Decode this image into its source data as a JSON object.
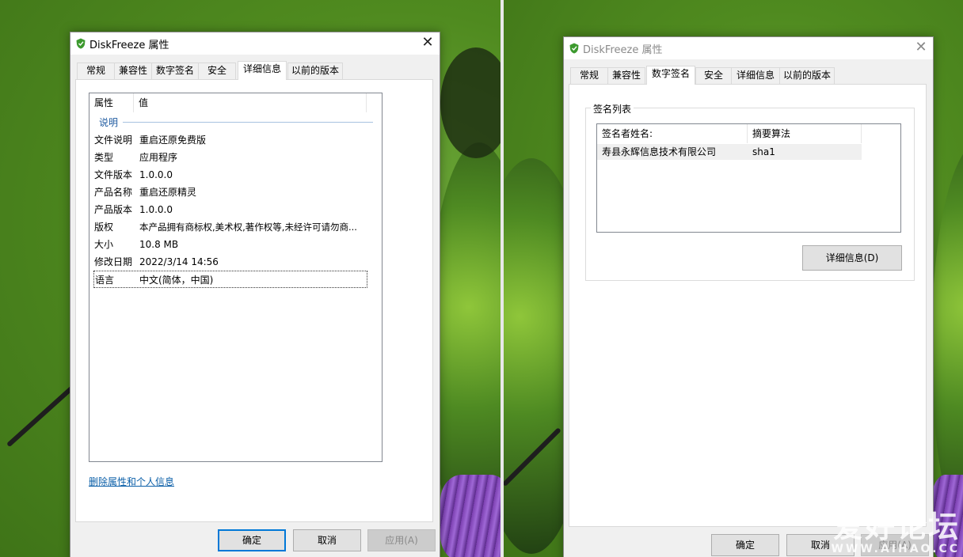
{
  "colors": {
    "accent": "#0078d7",
    "link": "#0b5fa8",
    "group": "#1e5aa0"
  },
  "left_window": {
    "title": "DiskFreeze 属性",
    "close_glyph": "✕",
    "icon": "shield-icon",
    "tabs": [
      "常规",
      "兼容性",
      "数字签名",
      "安全",
      "详细信息",
      "以前的版本"
    ],
    "active_tab": "详细信息",
    "columns": [
      "属性",
      "值"
    ],
    "group": "说明",
    "properties": [
      {
        "key": "文件说明",
        "value": "重启还原免费版"
      },
      {
        "key": "类型",
        "value": "应用程序"
      },
      {
        "key": "文件版本",
        "value": "1.0.0.0"
      },
      {
        "key": "产品名称",
        "value": "重启还原精灵"
      },
      {
        "key": "产品版本",
        "value": "1.0.0.0"
      },
      {
        "key": "版权",
        "value": "本产品拥有商标权,美术权,著作权等,未经许可请勿商..."
      },
      {
        "key": "大小",
        "value": "10.8 MB"
      },
      {
        "key": "修改日期",
        "value": "2022/3/14 14:56"
      },
      {
        "key": "语言",
        "value": "中文(简体，中国)"
      }
    ],
    "remove_link": "删除属性和个人信息",
    "buttons": {
      "ok": "确定",
      "cancel": "取消",
      "apply": "应用(A)"
    }
  },
  "right_window": {
    "title": "DiskFreeze 属性",
    "close_glyph": "✕",
    "icon": "shield-icon",
    "tabs": [
      "常规",
      "兼容性",
      "数字签名",
      "安全",
      "详细信息",
      "以前的版本"
    ],
    "active_tab": "数字签名",
    "group_title": "签名列表",
    "columns": [
      "签名者姓名:",
      "摘要算法"
    ],
    "signatures": [
      {
        "name": "寿县永辉信息技术有限公司",
        "algorithm": "sha1"
      }
    ],
    "details_button": "详细信息(D)",
    "buttons": {
      "ok": "确定",
      "cancel": "取消",
      "apply": "应用(A)"
    }
  },
  "watermark": {
    "main": "爱好论坛",
    "sub": "WWW.AIHAO.CC"
  }
}
